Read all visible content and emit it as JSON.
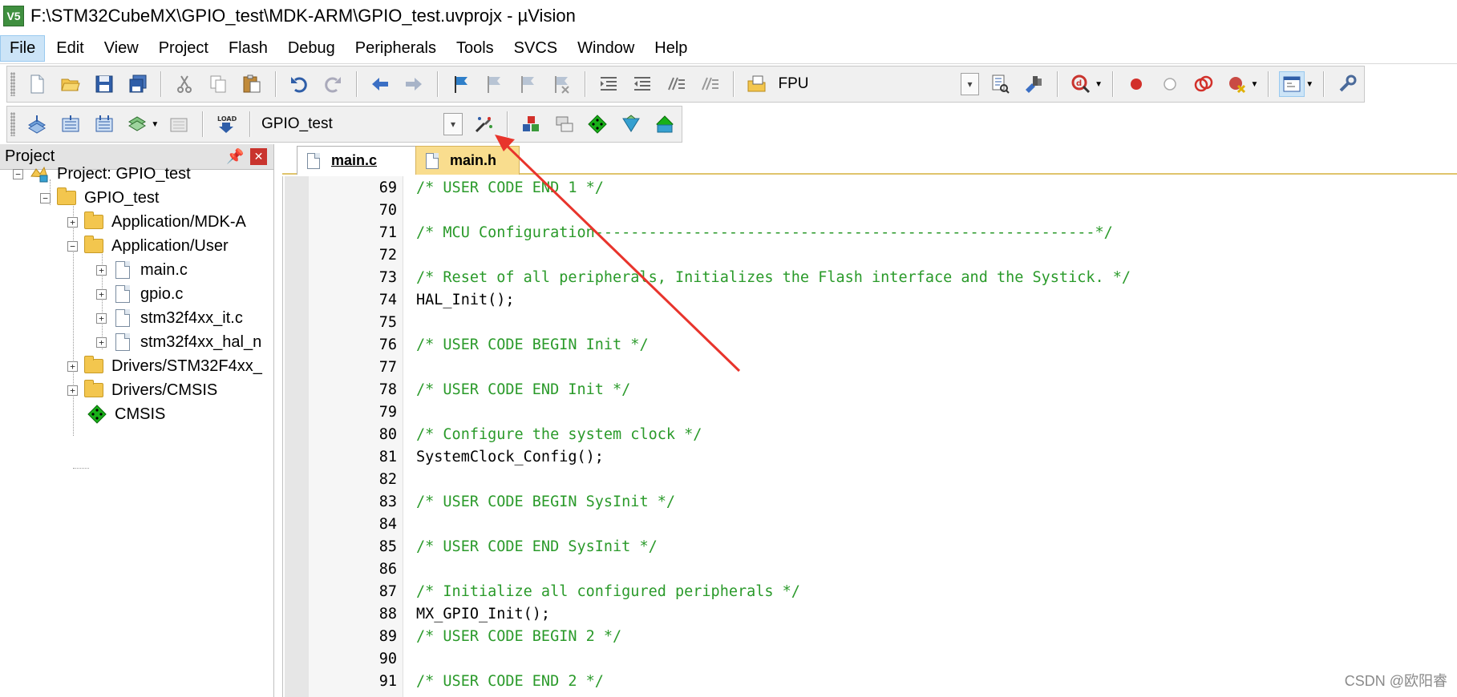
{
  "window": {
    "title": "F:\\STM32CubeMX\\GPIO_test\\MDK-ARM\\GPIO_test.uvprojx - µVision",
    "icon_label": "V5"
  },
  "menu": [
    "File",
    "Edit",
    "View",
    "Project",
    "Flash",
    "Debug",
    "Peripherals",
    "Tools",
    "SVCS",
    "Window",
    "Help"
  ],
  "toolbar1": {
    "target_combo_value": "FPU"
  },
  "toolbar2": {
    "target_combo_value": "GPIO_test",
    "load_label": "LOAD"
  },
  "project_panel": {
    "title": "Project",
    "tree": [
      {
        "label": "Project: GPIO_test",
        "expander": "−"
      },
      {
        "label": "GPIO_test",
        "expander": "−"
      },
      {
        "label": "Application/MDK-A",
        "expander": "+"
      },
      {
        "label": "Application/User",
        "expander": "−"
      },
      {
        "label": "main.c",
        "expander": "+"
      },
      {
        "label": "gpio.c",
        "expander": "+"
      },
      {
        "label": "stm32f4xx_it.c",
        "expander": "+"
      },
      {
        "label": "stm32f4xx_hal_n",
        "expander": "+"
      },
      {
        "label": "Drivers/STM32F4xx_",
        "expander": "+"
      },
      {
        "label": "Drivers/CMSIS",
        "expander": "+"
      },
      {
        "label": "CMSIS",
        "expander": ""
      }
    ]
  },
  "tabs": [
    {
      "label": "main.c",
      "active": true
    },
    {
      "label": "main.h",
      "active": false
    }
  ],
  "code": [
    {
      "num": "69",
      "text": "/* USER CODE END 1 */",
      "kind": "comment"
    },
    {
      "num": "70",
      "text": "",
      "kind": "code"
    },
    {
      "num": "71",
      "text": "/* MCU Configuration--------------------------------------------------------*/",
      "kind": "comment"
    },
    {
      "num": "72",
      "text": "",
      "kind": "code"
    },
    {
      "num": "73",
      "text": "/* Reset of all peripherals, Initializes the Flash interface and the Systick. */",
      "kind": "comment"
    },
    {
      "num": "74",
      "text": "HAL_Init();",
      "kind": "code"
    },
    {
      "num": "75",
      "text": "",
      "kind": "code"
    },
    {
      "num": "76",
      "text": "/* USER CODE BEGIN Init */",
      "kind": "comment"
    },
    {
      "num": "77",
      "text": "",
      "kind": "code"
    },
    {
      "num": "78",
      "text": "/* USER CODE END Init */",
      "kind": "comment"
    },
    {
      "num": "79",
      "text": "",
      "kind": "code"
    },
    {
      "num": "80",
      "text": "/* Configure the system clock */",
      "kind": "comment"
    },
    {
      "num": "81",
      "text": "SystemClock_Config();",
      "kind": "code"
    },
    {
      "num": "82",
      "text": "",
      "kind": "code"
    },
    {
      "num": "83",
      "text": "/* USER CODE BEGIN SysInit */",
      "kind": "comment"
    },
    {
      "num": "84",
      "text": "",
      "kind": "code"
    },
    {
      "num": "85",
      "text": "/* USER CODE END SysInit */",
      "kind": "comment"
    },
    {
      "num": "86",
      "text": "",
      "kind": "code"
    },
    {
      "num": "87",
      "text": "/* Initialize all configured peripherals */",
      "kind": "comment"
    },
    {
      "num": "88",
      "text": "MX_GPIO_Init();",
      "kind": "code"
    },
    {
      "num": "89",
      "text": "/* USER CODE BEGIN 2 */",
      "kind": "comment"
    },
    {
      "num": "90",
      "text": "",
      "kind": "code"
    },
    {
      "num": "91",
      "text": "/* USER CODE END 2 */",
      "kind": "comment"
    }
  ],
  "watermark": "CSDN @欧阳睿",
  "colors": {
    "comment": "#2a9a2a",
    "annotation_arrow": "#e8342c",
    "active_tab_border": "#e0c46c"
  }
}
